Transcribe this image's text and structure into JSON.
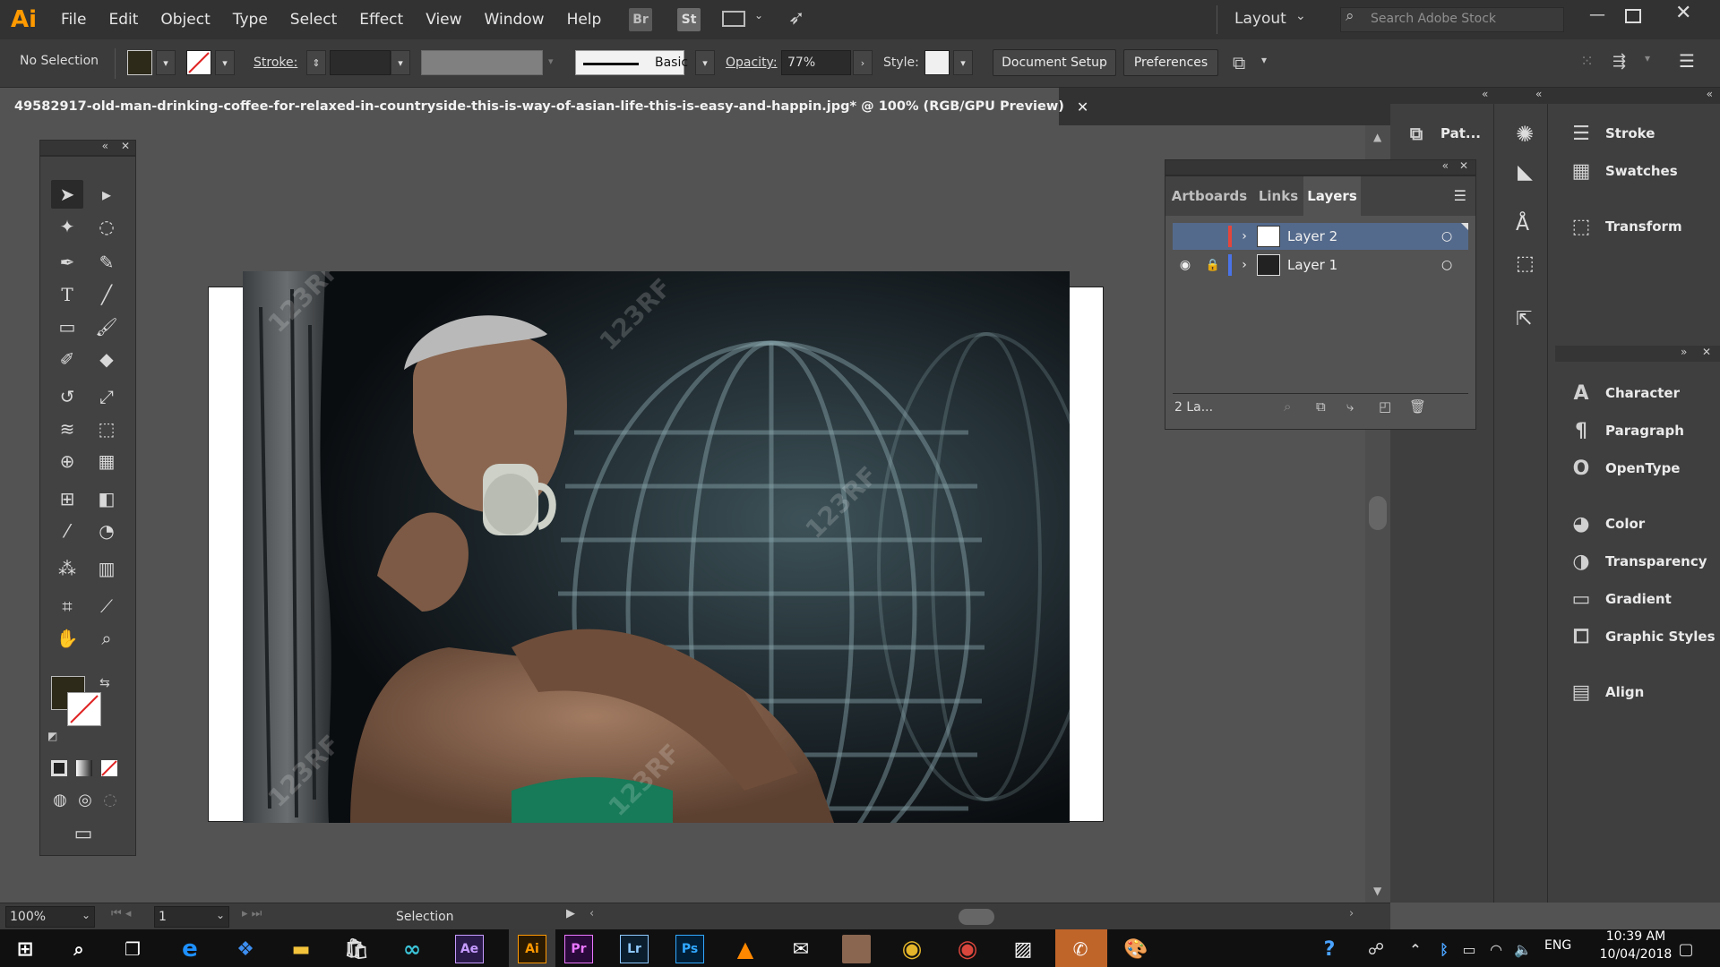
{
  "app": {
    "logo": "Ai",
    "accent": "#ff9a00"
  },
  "menu": [
    "File",
    "Edit",
    "Object",
    "Type",
    "Select",
    "Effect",
    "View",
    "Window",
    "Help"
  ],
  "menubar_icons": {
    "bridge": "Br",
    "stock": "St"
  },
  "workspace": {
    "label": "Layout",
    "search_placeholder": "Search Adobe Stock"
  },
  "control": {
    "selection": "No Selection",
    "stroke_label": "Stroke:",
    "brush": "Basic",
    "opacity_label": "Opacity:",
    "opacity_value": "77%",
    "style_label": "Style:",
    "document_setup": "Document Setup",
    "preferences": "Preferences",
    "fill_color": "#2d2a1a"
  },
  "document": {
    "title": "49582917-old-man-drinking-coffee-for-relaxed-in-countryside-this-is-way-of-asian-life-this-is-easy-and-happin.jpg* @ 100% (RGB/GPU Preview)",
    "watermark": "123RF"
  },
  "layers_panel": {
    "tabs": [
      "Artboards",
      "Links",
      "Layers"
    ],
    "active_tab": "Layers",
    "layers": [
      {
        "name": "Layer 2",
        "color": "#e5463c",
        "selected": true
      },
      {
        "name": "Layer 1",
        "color": "#4a73e8",
        "selected": false
      }
    ],
    "footer": "2 La..."
  },
  "dock": {
    "collapsed_top": "Pat...",
    "group1": [
      "Stroke",
      "Swatches",
      "Transform"
    ],
    "group2": [
      "Character",
      "Paragraph",
      "OpenType",
      "Color",
      "Transparency",
      "Gradient",
      "Graphic Styles",
      "Align"
    ]
  },
  "status": {
    "zoom": "100%",
    "artboard": "1",
    "tool": "Selection"
  },
  "taskbar": {
    "lang": "ENG",
    "time": "10:39 AM",
    "date": "10/04/2018"
  }
}
